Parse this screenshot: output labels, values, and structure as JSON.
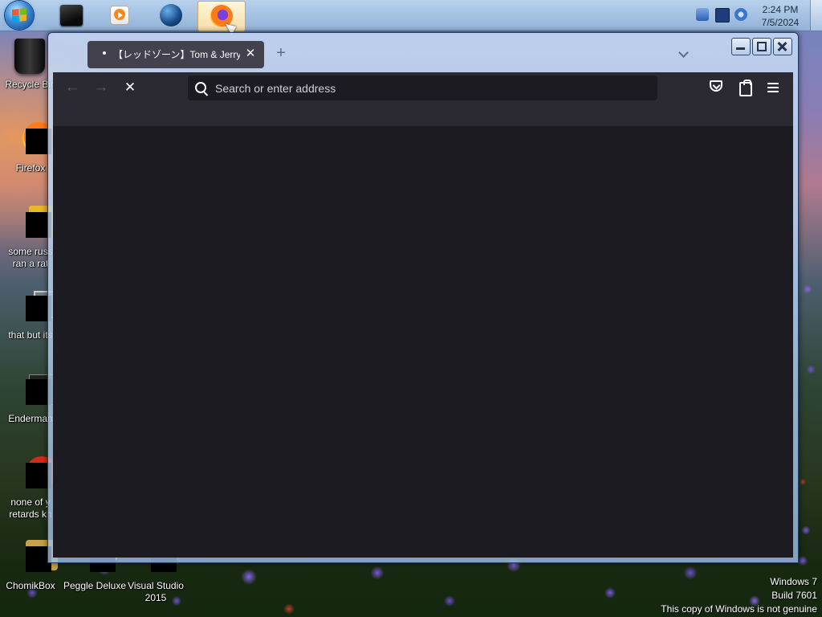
{
  "taskbar": {
    "apps": [
      {
        "name": "black-box-app",
        "active": false
      },
      {
        "name": "media-player",
        "active": false
      },
      {
        "name": "globe-app",
        "active": false
      },
      {
        "name": "firefox",
        "active": true
      }
    ],
    "clock": {
      "time": "2:24 PM",
      "date": "7/5/2024"
    }
  },
  "desktop": {
    "icons": [
      {
        "label": "Recycle Bin",
        "icon": "recycle-bin-icon"
      },
      {
        "label": "Firefox",
        "icon": "firefox-icon"
      },
      {
        "label": "some russ\nran a rat",
        "icon": "shortcut-icon"
      },
      {
        "label": "that but its",
        "icon": "shortcut-icon"
      },
      {
        "label": "Enderman",
        "icon": "shortcut-icon"
      },
      {
        "label": "none of y\nretards kn",
        "icon": "shortcut-icon"
      },
      {
        "label": "ChomikBox",
        "icon": "shortcut-icon"
      },
      {
        "label": "Peggle Deluxe",
        "icon": "shortcut-icon"
      },
      {
        "label": "Visual Studio\n2015",
        "icon": "shortcut-icon"
      }
    ]
  },
  "browser": {
    "tab": {
      "title": "【レッドゾーン】Tom & Jerry"
    },
    "new_tab": "+",
    "nav": {
      "back": "←",
      "forward": "→",
      "stop": "✕"
    },
    "urlbar": {
      "placeholder": "Search or enter address",
      "value": ""
    },
    "window_controls": [
      "minimize",
      "maximize",
      "close"
    ]
  },
  "watermark": {
    "line1": "Windows 7",
    "line2": "Build 7601",
    "line3": "This copy of Windows is not genuine"
  },
  "colors": {
    "browser_chrome": "#2b2a33",
    "content_bg": "#1c1b22",
    "tab_bg": "#42414d"
  }
}
